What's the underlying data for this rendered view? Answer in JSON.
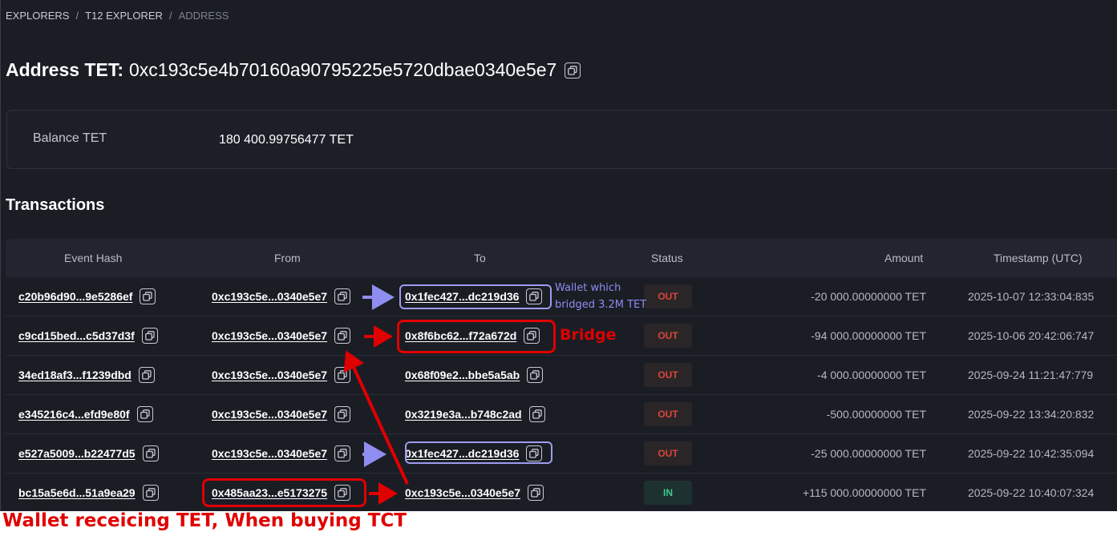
{
  "breadcrumb": {
    "items": [
      "EXPLORERS",
      "T12 EXPLORER",
      "ADDRESS"
    ],
    "separator": "/"
  },
  "address": {
    "label": "Address TET:",
    "value": "0xc193c5e4b70160a90795225e5720dbae0340e5e7"
  },
  "balance": {
    "label": "Balance TET",
    "value": "180 400.99756477 TET"
  },
  "transactions": {
    "title": "Transactions",
    "columns": [
      "Event Hash",
      "From",
      "To",
      "Status",
      "Amount",
      "Timestamp (UTC)"
    ],
    "rows": [
      {
        "hash": "c20b96d90...9e5286ef",
        "from": "0xc193c5e...0340e5e7",
        "to": "0x1fec427...dc219d36",
        "status": "OUT",
        "amount": "-20 000.00000000 TET",
        "timestamp": "2025-10-07 12:33:04:835"
      },
      {
        "hash": "c9cd15bed...c5d37d3f",
        "from": "0xc193c5e...0340e5e7",
        "to": "0x8f6bc62...f72a672d",
        "status": "OUT",
        "amount": "-94 000.00000000 TET",
        "timestamp": "2025-10-06 20:42:06:747"
      },
      {
        "hash": "34ed18af3...f1239dbd",
        "from": "0xc193c5e...0340e5e7",
        "to": "0x68f09e2...bbe5a5ab",
        "status": "OUT",
        "amount": "-4 000.00000000 TET",
        "timestamp": "2025-09-24 11:21:47:779"
      },
      {
        "hash": "e345216c4...efd9e80f",
        "from": "0xc193c5e...0340e5e7",
        "to": "0x3219e3a...b748c2ad",
        "status": "OUT",
        "amount": "-500.00000000 TET",
        "timestamp": "2025-09-22 13:34:20:832"
      },
      {
        "hash": "e527a5009...b22477d5",
        "from": "0xc193c5e...0340e5e7",
        "to": "0x1fec427...dc219d36",
        "status": "OUT",
        "amount": "-25 000.00000000 TET",
        "timestamp": "2025-09-22 10:42:35:094"
      },
      {
        "hash": "bc15a5e6d...51a9ea29",
        "from": "0x485aa23...e5173275",
        "to": "0xc193c5e...0340e5e7",
        "status": "IN",
        "amount": "+115 000.00000000 TET",
        "timestamp": "2025-09-22 10:40:07:324"
      }
    ]
  },
  "annotations": {
    "purple_note": [
      "Wallet which",
      "bridged 3.2M TET"
    ],
    "bridge_label": "Bridge",
    "bottom_caption": "Wallet receicing TET, When buying TCT",
    "colors": {
      "red": "#e00000",
      "purple": "#9d9cf0"
    }
  },
  "icons": {
    "copy": "copy-icon"
  },
  "colors": {
    "background": "#1b1d25",
    "out": "#d9453a",
    "in": "#3ec98a"
  }
}
